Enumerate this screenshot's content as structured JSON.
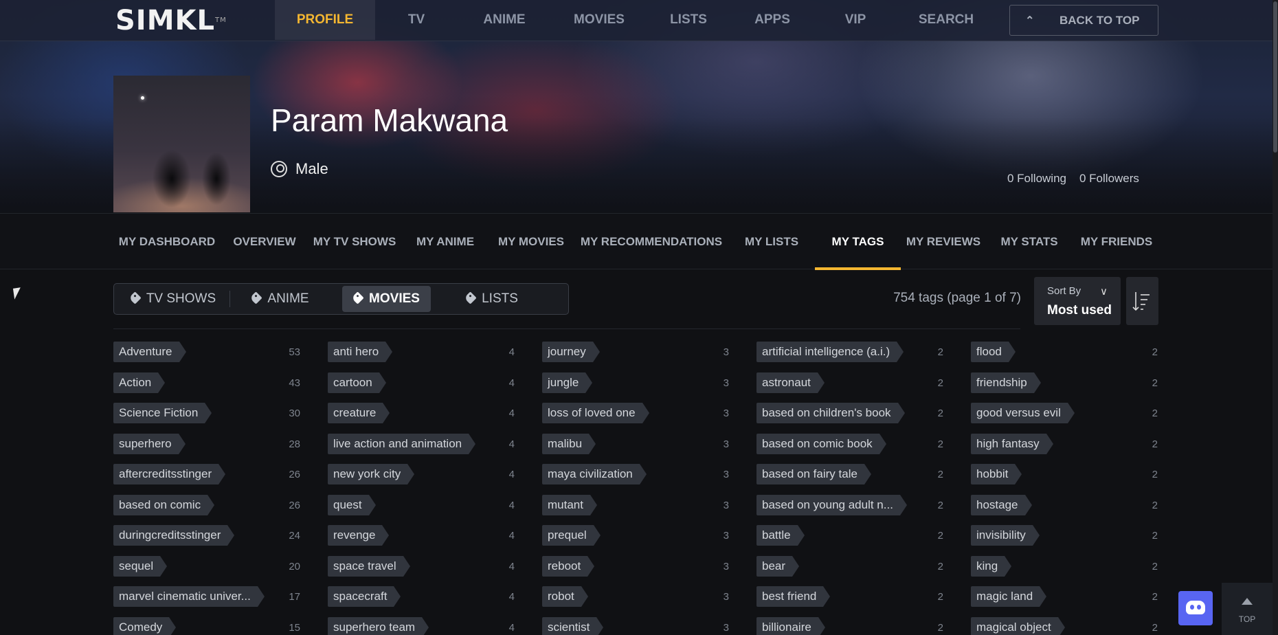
{
  "brand": {
    "logo": "SIMKL",
    "trademark": "TM"
  },
  "topnav": {
    "items": [
      {
        "label": "PROFILE",
        "active": true
      },
      {
        "label": "TV"
      },
      {
        "label": "ANIME"
      },
      {
        "label": "MOVIES"
      },
      {
        "label": "LISTS"
      },
      {
        "label": "APPS"
      },
      {
        "label": "VIP"
      },
      {
        "label": "SEARCH"
      }
    ],
    "back_to_top": "BACK TO TOP"
  },
  "profile": {
    "name": "Param Makwana",
    "gender": "Male",
    "following": "0 Following",
    "followers": "0 Followers"
  },
  "subnav": {
    "items": [
      {
        "label": "MY DASHBOARD"
      },
      {
        "label": "OVERVIEW"
      },
      {
        "label": "MY TV SHOWS"
      },
      {
        "label": "MY ANIME"
      },
      {
        "label": "MY MOVIES"
      },
      {
        "label": "MY RECOMMENDATIONS"
      },
      {
        "label": "MY LISTS"
      },
      {
        "label": "MY TAGS",
        "active": true
      },
      {
        "label": "MY REVIEWS"
      },
      {
        "label": "MY STATS"
      },
      {
        "label": "MY FRIENDS"
      }
    ]
  },
  "type_tabs": {
    "items": [
      {
        "label": "TV SHOWS"
      },
      {
        "label": "ANIME"
      },
      {
        "label": "MOVIES",
        "active": true
      },
      {
        "label": "LISTS"
      }
    ]
  },
  "tags_summary": "754 tags (page 1 of 7)",
  "sort": {
    "label": "Sort By",
    "value": "Most used"
  },
  "tag_columns": [
    [
      {
        "name": "Adventure",
        "count": "53"
      },
      {
        "name": "Action",
        "count": "43"
      },
      {
        "name": "Science Fiction",
        "count": "30"
      },
      {
        "name": "superhero",
        "count": "28"
      },
      {
        "name": "aftercreditsstinger",
        "count": "26"
      },
      {
        "name": "based on comic",
        "count": "26"
      },
      {
        "name": "duringcreditsstinger",
        "count": "24"
      },
      {
        "name": "sequel",
        "count": "20"
      },
      {
        "name": "marvel cinematic univer...",
        "count": "17"
      },
      {
        "name": "Comedy",
        "count": "15"
      }
    ],
    [
      {
        "name": "anti hero",
        "count": "4"
      },
      {
        "name": "cartoon",
        "count": "4"
      },
      {
        "name": "creature",
        "count": "4"
      },
      {
        "name": "live action and animation",
        "count": "4"
      },
      {
        "name": "new york city",
        "count": "4"
      },
      {
        "name": "quest",
        "count": "4"
      },
      {
        "name": "revenge",
        "count": "4"
      },
      {
        "name": "space travel",
        "count": "4"
      },
      {
        "name": "spacecraft",
        "count": "4"
      },
      {
        "name": "superhero team",
        "count": "4"
      }
    ],
    [
      {
        "name": "journey",
        "count": "3"
      },
      {
        "name": "jungle",
        "count": "3"
      },
      {
        "name": "loss of loved one",
        "count": "3"
      },
      {
        "name": "malibu",
        "count": "3"
      },
      {
        "name": "maya civilization",
        "count": "3"
      },
      {
        "name": "mutant",
        "count": "3"
      },
      {
        "name": "prequel",
        "count": "3"
      },
      {
        "name": "reboot",
        "count": "3"
      },
      {
        "name": "robot",
        "count": "3"
      },
      {
        "name": "scientist",
        "count": "3"
      }
    ],
    [
      {
        "name": "artificial intelligence (a.i.)",
        "count": "2"
      },
      {
        "name": "astronaut",
        "count": "2"
      },
      {
        "name": "based on children's book",
        "count": "2"
      },
      {
        "name": "based on comic book",
        "count": "2"
      },
      {
        "name": "based on fairy tale",
        "count": "2"
      },
      {
        "name": "based on young adult n...",
        "count": "2"
      },
      {
        "name": "battle",
        "count": "2"
      },
      {
        "name": "bear",
        "count": "2"
      },
      {
        "name": "best friend",
        "count": "2"
      },
      {
        "name": "billionaire",
        "count": "2"
      }
    ],
    [
      {
        "name": "flood",
        "count": "2"
      },
      {
        "name": "friendship",
        "count": "2"
      },
      {
        "name": "good versus evil",
        "count": "2"
      },
      {
        "name": "high fantasy",
        "count": "2"
      },
      {
        "name": "hobbit",
        "count": "2"
      },
      {
        "name": "hostage",
        "count": "2"
      },
      {
        "name": "invisibility",
        "count": "2"
      },
      {
        "name": "king",
        "count": "2"
      },
      {
        "name": "magic land",
        "count": "2"
      },
      {
        "name": "magical object",
        "count": "2"
      }
    ]
  ],
  "floating": {
    "top_label": "TOP",
    "discord_icon": "discord-icon"
  },
  "colors": {
    "accent": "#f5b731",
    "background": "#101114",
    "tag_bg": "#31353d",
    "discord": "#5865f2"
  }
}
